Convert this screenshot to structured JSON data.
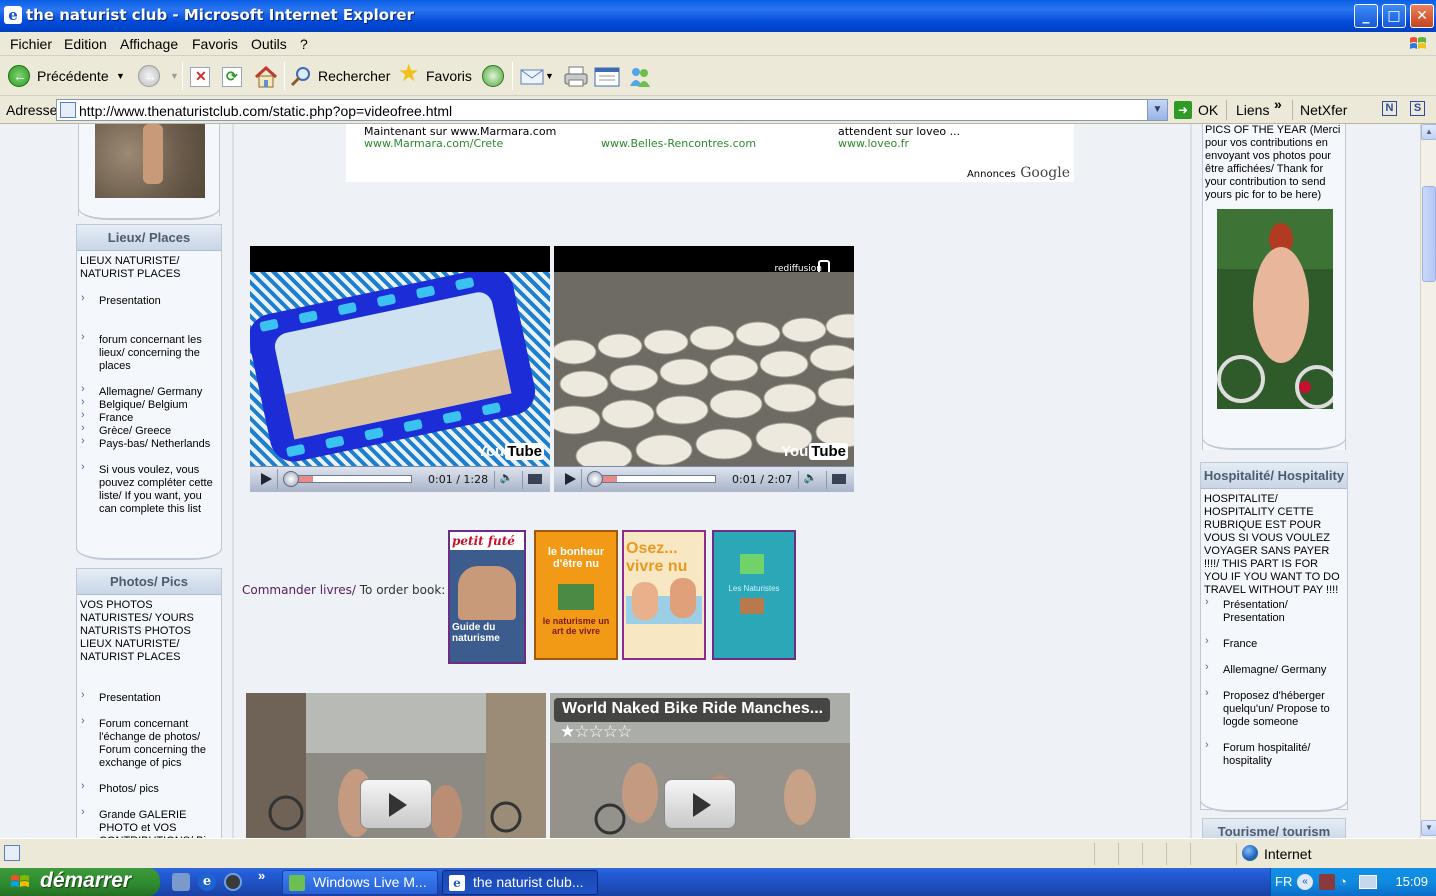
{
  "window": {
    "title": "the naturist club - Microsoft Internet Explorer",
    "buttons": {
      "minimize": "_",
      "maximize": "□",
      "close": "✕"
    }
  },
  "menu": [
    "Fichier",
    "Edition",
    "Affichage",
    "Favoris",
    "Outils",
    "?"
  ],
  "toolbar": {
    "back": "Précédente",
    "search": "Rechercher",
    "favorites": "Favoris"
  },
  "address": {
    "label": "Adresse",
    "url": "http://www.thenaturistclub.com/static.php?op=videofree.html",
    "go": "OK",
    "links": "Liens",
    "links_chevron": "»",
    "netxfer": "NetXfer",
    "n_badge": "N",
    "s_badge": "S"
  },
  "ads": {
    "col1": {
      "line1": "Maintenant sur www.Marmara.com",
      "link": "www.Marmara.com/Crete"
    },
    "col2": {
      "link": "www.Belles-Rencontres.com"
    },
    "col3": {
      "line1": "attendent sur loveo ...",
      "link": "www.loveo.fr"
    },
    "footer_prefix": "Annonces",
    "footer_brand": "Google"
  },
  "left": {
    "places": {
      "title": "Lieux/ Places",
      "intro": "LIEUX NATURISTE/ NATURIST PLACES",
      "items": [
        "Presentation",
        "forum concernant les lieux/ concerning the places",
        "Allemagne/ Germany",
        "Belgique/ Belgium",
        "France",
        "Grèce/ Greece",
        "Pays-bas/ Netherlands",
        "Si vous voulez, vous pouvez compléter cette liste/ If you want, you can complete this list"
      ]
    },
    "photos": {
      "title": "Photos/ Pics",
      "intro": "VOS PHOTOS NATURISTES/ YOURS NATURISTS PHOTOS LIEUX NATURISTE/ NATURIST PLACES",
      "items": [
        "Presentation",
        "Forum concernant l'échange de photos/ Forum concerning the exchange of pics",
        "Photos/ pics",
        "Grande GALERIE PHOTO et VOS CONTRIBUTIONS/ Big"
      ]
    }
  },
  "center": {
    "video1": {
      "time": "0:01 / 1:28",
      "progress": 0.01
    },
    "video2": {
      "time": "0:01 / 2:07",
      "overlay": "rediffusion",
      "progress": 0.01
    },
    "youtube_you": "You",
    "youtube_tube": "Tube",
    "order_label": "Commander livres/",
    "order_label2": " To order book:",
    "books": [
      {
        "title": "petit futé",
        "subtitle": "Guide du naturisme",
        "color": "#2E5FA8"
      },
      {
        "title": "le bonheur d'être nu",
        "subtitle": "le naturisme un art de vivre",
        "color": "#F29A16"
      },
      {
        "title": "Osez... vivre nu",
        "color": "#F7E7C2"
      },
      {
        "title": "Les Naturistes",
        "color": "#2BA7B8"
      }
    ],
    "video3": {
      "title": ""
    },
    "video4": {
      "title": "World Naked Bike Ride Manches...",
      "stars": "★☆☆☆☆"
    }
  },
  "right": {
    "pics_text": "PICS OF THE YEAR (Merci pour vos contributions en envoyant vos photos pour être affichées/ Thank for your contribution to send yours pic for to be here)",
    "hospitality": {
      "title": "Hospitalité/ Hospitality",
      "intro": "HOSPITALITE/ HOSPITALITY CETTE RUBRIQUE EST POUR VOUS SI VOUS VOULEZ VOYAGER SANS PAYER !!!!/ THIS PART IS FOR YOU IF YOU WANT TO DO TRAVEL WITHOUT PAY !!!!",
      "items": [
        "Présentation/ Presentation",
        "France",
        "Allemagne/ Germany",
        "Proposez d'héberger quelqu'un/ Propose to logde someone",
        "Forum hospitalité/ hospitality"
      ]
    },
    "tourism": {
      "title": "Tourisme/ tourism"
    }
  },
  "status": {
    "zone": "Internet"
  },
  "taskbar": {
    "start": "démarrer",
    "tasks": [
      "Windows Live M...",
      "the naturist club..."
    ],
    "quick_chevron": "»",
    "lang": "FR",
    "clock": "15:09"
  }
}
